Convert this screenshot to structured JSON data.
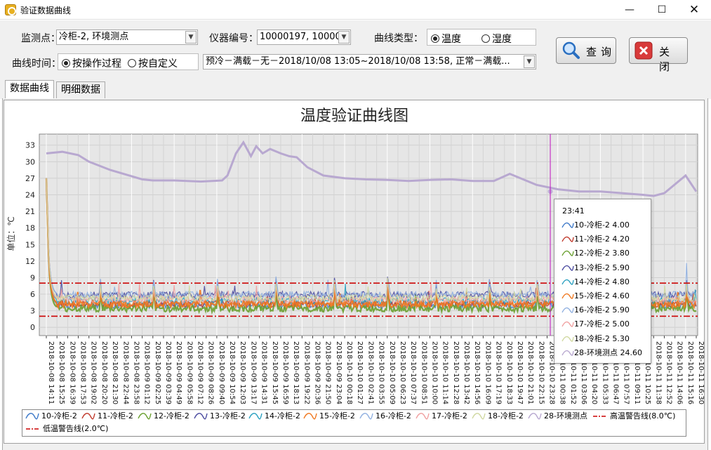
{
  "window": {
    "title": "验证数据曲线"
  },
  "form": {
    "monitor_label": "监测点：",
    "monitor_value": "冷柜-2, 环境测点",
    "device_label": "仪器编号：",
    "device_value": "10000197, 10000...",
    "curve_type_label": "曲线类型：",
    "curve_types": [
      "温度",
      "湿度"
    ],
    "curve_type_selected": "温度",
    "time_label": "曲线时间：",
    "time_modes": [
      "按操作过程",
      "按自定义"
    ],
    "time_mode_selected": "按操作过程",
    "process_value": "预冷－满载－无－2018/10/08 13:05~2018/10/08 13:58, 正常－满载...",
    "query_label": "查询",
    "close_label": "关闭"
  },
  "tabs": [
    {
      "label": "数据曲线",
      "active": true
    },
    {
      "label": "明细数据",
      "active": false
    }
  ],
  "chart_data": {
    "type": "line",
    "title": "温度验证曲线图",
    "ylabel": "单位：℃",
    "y_ticks": [
      0,
      3,
      6,
      9,
      12,
      15,
      18,
      21,
      24,
      27,
      30,
      33
    ],
    "ylim": [
      -1.5,
      35
    ],
    "x_tick_labels": [
      "2018-10-08 14:11",
      "2018-10-08 15:25",
      "2018-10-08 16:39",
      "2018-10-08 17:53",
      "2018-10-08 19:02",
      "2018-10-08 20:20",
      "2018-10-08 21:30",
      "2018-10-08 22:44",
      "2018-10-08 23:58",
      "2018-10-09 01:12",
      "2018-10-09 02:25",
      "2018-10-09 03:39",
      "2018-10-09 04:49",
      "2018-10-09 05:58",
      "2018-10-09 07:12",
      "2018-10-09 08:26",
      "2018-10-09 09:40",
      "2018-10-09 10:54",
      "2018-10-09 12:03",
      "2018-10-09 13:17",
      "2018-10-09 14:31",
      "2018-10-09 15:45",
      "2018-10-09 16:59",
      "2018-10-09 18:13",
      "2018-10-09 19:22",
      "2018-10-09 20:36",
      "2018-10-09 21:50",
      "2018-10-09 23:04",
      "2018-10-10 00:18",
      "2018-10-10 01:27",
      "2018-10-10 02:41",
      "2018-10-10 03:55",
      "2018-10-10 05:09",
      "2018-10-10 06:23",
      "2018-10-10 07:37",
      "2018-10-10 08:51",
      "2018-10-10 10:00",
      "2018-10-10 11:14",
      "2018-10-10 12:28",
      "2018-10-10 13:42",
      "2018-10-10 14:56",
      "2018-10-10 16:09",
      "2018-10-10 17:19",
      "2018-10-10 18:33",
      "2018-10-10 19:47",
      "2018-10-10 21:01",
      "2018-10-10 22:15",
      "2018-10-10 23:28",
      "2018-10-11 00:38",
      "2018-10-11 01:52",
      "2018-10-11 03:06",
      "2018-10-11 04:20",
      "2018-10-11 05:33",
      "2018-10-11 06:47",
      "2018-10-11 07:57",
      "2018-10-11 09:11",
      "2018-10-11 10:25",
      "2018-10-11 11:38",
      "2018-10-11 12:52",
      "2018-10-11 14:06",
      "2018-10-11 15:16",
      "2018-10-11 16:30"
    ],
    "series": [
      {
        "name": "10-冷柜-2",
        "color": "#3c78c8",
        "base": 4.0
      },
      {
        "name": "11-冷柜-2",
        "color": "#c0392b",
        "base": 4.2
      },
      {
        "name": "12-冷柜-2",
        "color": "#6aa030",
        "base": 3.4
      },
      {
        "name": "13-冷柜-2",
        "color": "#4b4ba0",
        "base": 5.9
      },
      {
        "name": "14-冷柜-2",
        "color": "#2aa0c0",
        "base": 4.8
      },
      {
        "name": "15-冷柜-2",
        "color": "#f07820",
        "base": 4.2
      },
      {
        "name": "16-冷柜-2",
        "color": "#90b0e0",
        "base": 5.9
      },
      {
        "name": "17-冷柜-2",
        "color": "#f0a0a0",
        "base": 5.0
      },
      {
        "name": "18-冷柜-2",
        "color": "#d0d8a0",
        "base": 5.3
      },
      {
        "name": "28-环境测点",
        "color": "#b8a8d0",
        "base": 24.6
      }
    ],
    "ambient_series": {
      "name": "28-环境测点",
      "x": [
        0,
        1.5,
        3,
        4,
        6,
        9,
        10,
        12,
        14.5,
        16.5,
        17,
        17.8,
        18.5,
        19.2,
        19.7,
        20.3,
        21,
        22,
        22.8,
        23.5,
        24.5,
        26,
        28,
        30,
        32,
        34,
        36,
        38,
        40,
        42,
        43.5,
        44.5,
        46,
        48,
        50,
        52,
        54,
        56,
        57,
        58,
        60,
        61
      ],
      "y": [
        31.5,
        31.8,
        31.2,
        30.0,
        28.5,
        26.8,
        26.6,
        26.6,
        26.4,
        26.6,
        27.5,
        31.5,
        33.5,
        31.0,
        32.8,
        31.5,
        32.3,
        31.5,
        31.0,
        30.8,
        29.0,
        27.5,
        27.0,
        26.8,
        26.7,
        26.5,
        26.7,
        26.8,
        26.5,
        26.5,
        27.8,
        27.0,
        25.8,
        25.0,
        24.6,
        24.6,
        24.3,
        24.0,
        23.8,
        24.3,
        27.5,
        24.6
      ]
    },
    "warning_lines": [
      {
        "name": "高温警告线(8.0℃)",
        "value": 8.0,
        "color": "#cc0000"
      },
      {
        "name": "低温警告线(2.0℃)",
        "value": 2.0,
        "color": "#cc0000"
      }
    ],
    "cursor_x_label": "2018-10-10 23:28",
    "tooltip": {
      "time": "23:41",
      "rows": [
        "10-冷柜-2 4.00",
        "11-冷柜-2 4.20",
        "12-冷柜-2 3.80",
        "13-冷柜-2 5.90",
        "14-冷柜-2 4.80",
        "15-冷柜-2 4.60",
        "16-冷柜-2 5.90",
        "17-冷柜-2 5.00",
        "18-冷柜-2 5.30",
        "28-环境测点 24.60"
      ]
    },
    "legend": {
      "items": [
        "10-冷柜-2",
        "11-冷柜-2",
        "12-冷柜-2",
        "13-冷柜-2",
        "14-冷柜-2",
        "15-冷柜-2",
        "16-冷柜-2",
        "17-冷柜-2",
        "18-冷柜-2",
        "28-环境测点",
        "高温警告线(8.0℃)",
        "低温警告线(2.0℃)"
      ]
    }
  }
}
